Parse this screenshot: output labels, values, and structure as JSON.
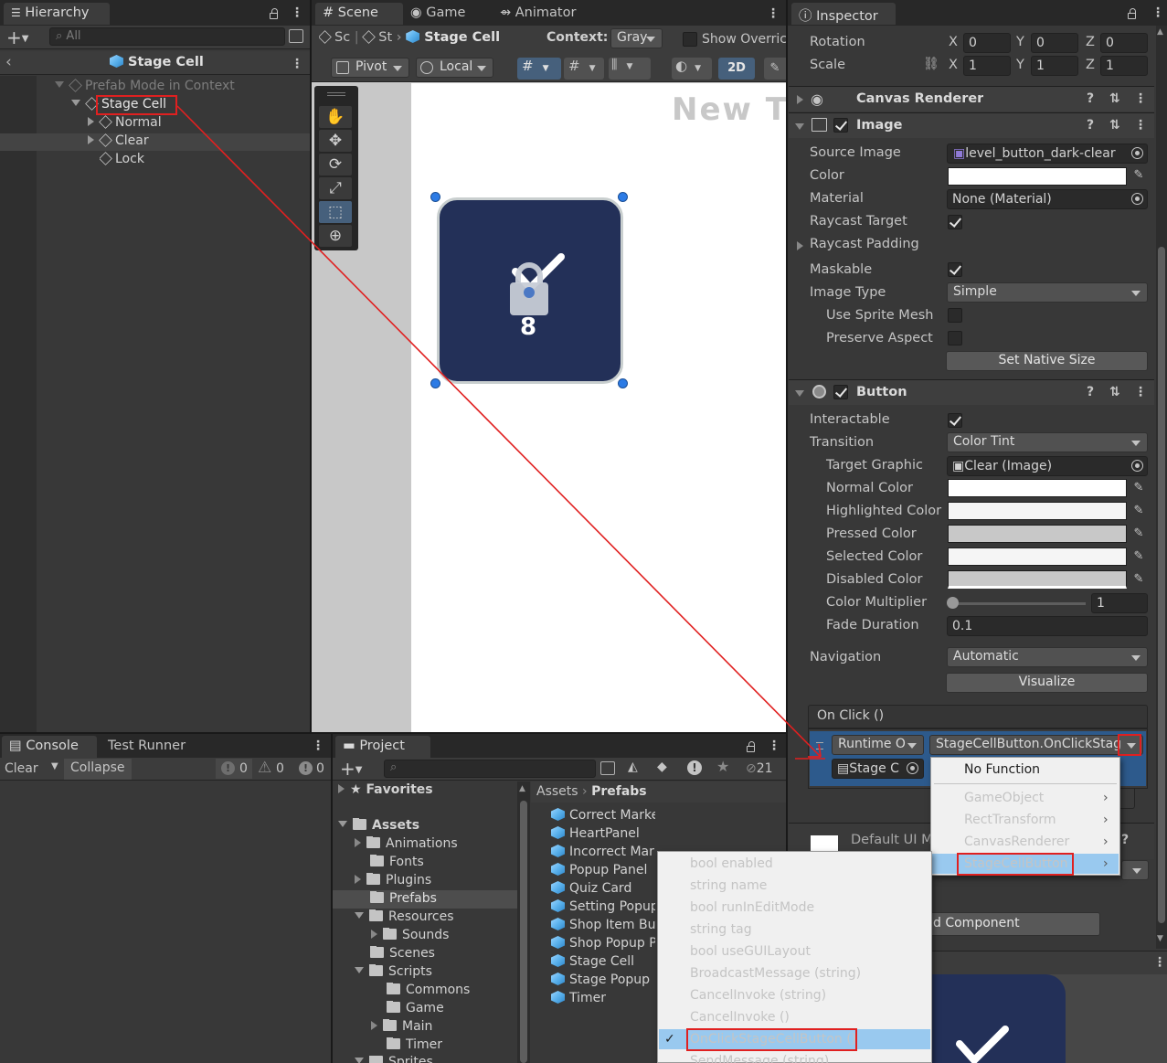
{
  "hierarchy": {
    "tab": "Hierarchy",
    "search_placeholder": "All",
    "breadcrumb_title": "Stage Cell",
    "items": [
      {
        "label": "Prefab Mode in Context"
      },
      {
        "label": "Stage Cell"
      },
      {
        "label": "Normal"
      },
      {
        "label": "Clear"
      },
      {
        "label": "Lock"
      }
    ]
  },
  "scene": {
    "tabs": [
      "Scene",
      "Game",
      "Animator"
    ],
    "breadcrumb": [
      "Sc",
      "St",
      "Stage Cell"
    ],
    "context_label": "Context:",
    "context_value": "Gray",
    "show_overrides": "Show Overric",
    "pivot": "Pivot",
    "local": "Local",
    "mode_2d": "2D",
    "canvas_text": "New Te",
    "cell_number": "8"
  },
  "inspector": {
    "tab": "Inspector",
    "transform": {
      "rotation_label": "Rotation",
      "scale_label": "Scale",
      "rotation": {
        "x": "0",
        "y": "0",
        "z": "0"
      },
      "scale": {
        "x": "1",
        "y": "1",
        "z": "1"
      },
      "axis": {
        "x": "X",
        "y": "Y",
        "z": "Z"
      }
    },
    "canvas_renderer": {
      "title": "Canvas Renderer"
    },
    "image": {
      "title": "Image",
      "source_image_label": "Source Image",
      "source_image_value": "level_button_dark-clear",
      "color_label": "Color",
      "material_label": "Material",
      "material_value": "None (Material)",
      "raycast_target_label": "Raycast Target",
      "raycast_padding_label": "Raycast Padding",
      "maskable_label": "Maskable",
      "image_type_label": "Image Type",
      "image_type_value": "Simple",
      "use_sprite_mesh_label": "Use Sprite Mesh",
      "preserve_aspect_label": "Preserve Aspect",
      "set_native_size": "Set Native Size"
    },
    "button": {
      "title": "Button",
      "interactable_label": "Interactable",
      "transition_label": "Transition",
      "transition_value": "Color Tint",
      "target_graphic_label": "Target Graphic",
      "target_graphic_value": "Clear (Image)",
      "normal_color_label": "Normal Color",
      "highlighted_color_label": "Highlighted Color",
      "pressed_color_label": "Pressed Color",
      "selected_color_label": "Selected Color",
      "disabled_color_label": "Disabled Color",
      "color_multiplier_label": "Color Multiplier",
      "color_multiplier_value": "1",
      "fade_duration_label": "Fade Duration",
      "fade_duration_value": "0.1",
      "navigation_label": "Navigation",
      "navigation_value": "Automatic",
      "visualize": "Visualize",
      "onclick_title": "On Click ()",
      "runtime_value": "Runtime O",
      "function_value": "StageCellButton.OnClickStag",
      "object_value": "Stage C"
    },
    "default_ui": "Default UI M",
    "add_component": "d Component"
  },
  "function_menu": {
    "items": [
      "No Function",
      "GameObject",
      "RectTransform",
      "CanvasRenderer",
      "StageCellButton"
    ]
  },
  "method_menu": {
    "items": [
      "bool enabled",
      "string name",
      "bool runInEditMode",
      "string tag",
      "bool useGUILayout",
      "BroadcastMessage (string)",
      "CancelInvoke (string)",
      "CancelInvoke ()",
      "OnClickStageCellButton ()",
      "SendMessage (string)"
    ],
    "selected": "OnClickStageCellButton ()"
  },
  "console": {
    "tabs": [
      "Console",
      "Test Runner"
    ],
    "clear": "Clear",
    "collapse": "Collapse",
    "counts": {
      "log": "0",
      "warn": "0",
      "error": "0"
    }
  },
  "project": {
    "tab": "Project",
    "hidden_count": "21",
    "favorites": "Favorites",
    "tree": [
      {
        "label": "Assets"
      },
      {
        "label": "Animations"
      },
      {
        "label": "Fonts"
      },
      {
        "label": "Plugins"
      },
      {
        "label": "Prefabs"
      },
      {
        "label": "Resources"
      },
      {
        "label": "Sounds"
      },
      {
        "label": "Scenes"
      },
      {
        "label": "Scripts"
      },
      {
        "label": "Commons"
      },
      {
        "label": "Game"
      },
      {
        "label": "Main"
      },
      {
        "label": "Timer"
      },
      {
        "label": "Sprites"
      }
    ],
    "path": [
      "Assets",
      "Prefabs"
    ],
    "assets": [
      "Correct Marker",
      "HeartPanel",
      "Incorrect Marker",
      "Popup Panel",
      "Quiz Card",
      "Setting Popup",
      "Shop Item Bu",
      "Shop Popup P",
      "Stage Cell",
      "Stage Popup",
      "Timer"
    ]
  },
  "colors": {
    "accent_selection": "#3d5f87",
    "highlight_red": "#e02020",
    "cell_fill": "#233058",
    "menu_selected": "#99c9ef"
  }
}
